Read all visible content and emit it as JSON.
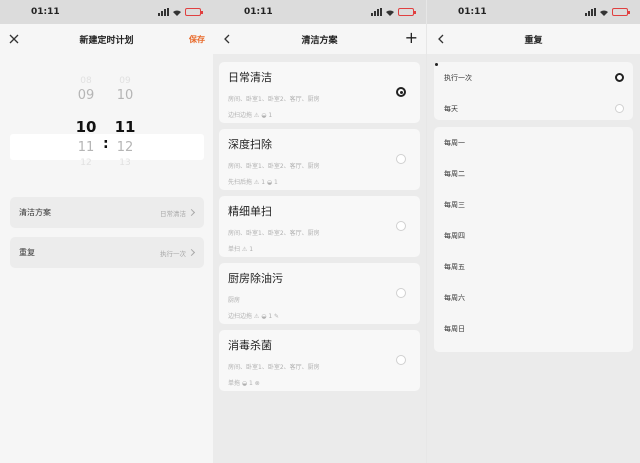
{
  "status": {
    "time": "01:11"
  },
  "panel1": {
    "title": "新建定时计划",
    "save_label": "保存",
    "hours": [
      "08",
      "09",
      "10",
      "11",
      "12"
    ],
    "minutes": [
      "09",
      "10",
      "11",
      "12",
      "13"
    ],
    "hours_selected": "10",
    "minutes_selected": "11",
    "colon": ":",
    "plan_label": "清洁方案",
    "plan_value": "日常清洁",
    "repeat_label": "重复",
    "repeat_value": "执行一次"
  },
  "panel2": {
    "title": "清洁方案",
    "plus_label": "+",
    "cards": [
      {
        "title": "日常清洁",
        "rooms": "房间、卧室1、卧室2、客厅、厨房",
        "meta": "边扫边拖  ⚠ ◒ 1",
        "selected": true
      },
      {
        "title": "深度扫除",
        "rooms": "房间、卧室1、卧室2、客厅、厨房",
        "meta": "先扫后拖  ⚠ 1 ◒ 1",
        "selected": false
      },
      {
        "title": "精细单扫",
        "rooms": "房间、卧室1、卧室2、客厅、厨房",
        "meta": "单扫  ⚠ 1",
        "selected": false
      },
      {
        "title": "厨房除油污",
        "rooms": "厨房",
        "meta": "边扫边拖  ⚠ ◒ 1 ✎",
        "selected": false
      },
      {
        "title": "消毒杀菌",
        "rooms": "房间、卧室1、卧室2、客厅、厨房",
        "meta": "单拖  ◒ 1 ⊗",
        "selected": false
      }
    ]
  },
  "panel3": {
    "title": "重复",
    "options_top": [
      {
        "label": "执行一次",
        "selected": true
      },
      {
        "label": "每天",
        "selected": false
      }
    ],
    "weekdays": [
      "每周一",
      "每周二",
      "每周三",
      "每周四",
      "每周五",
      "每周六",
      "每周日"
    ]
  }
}
